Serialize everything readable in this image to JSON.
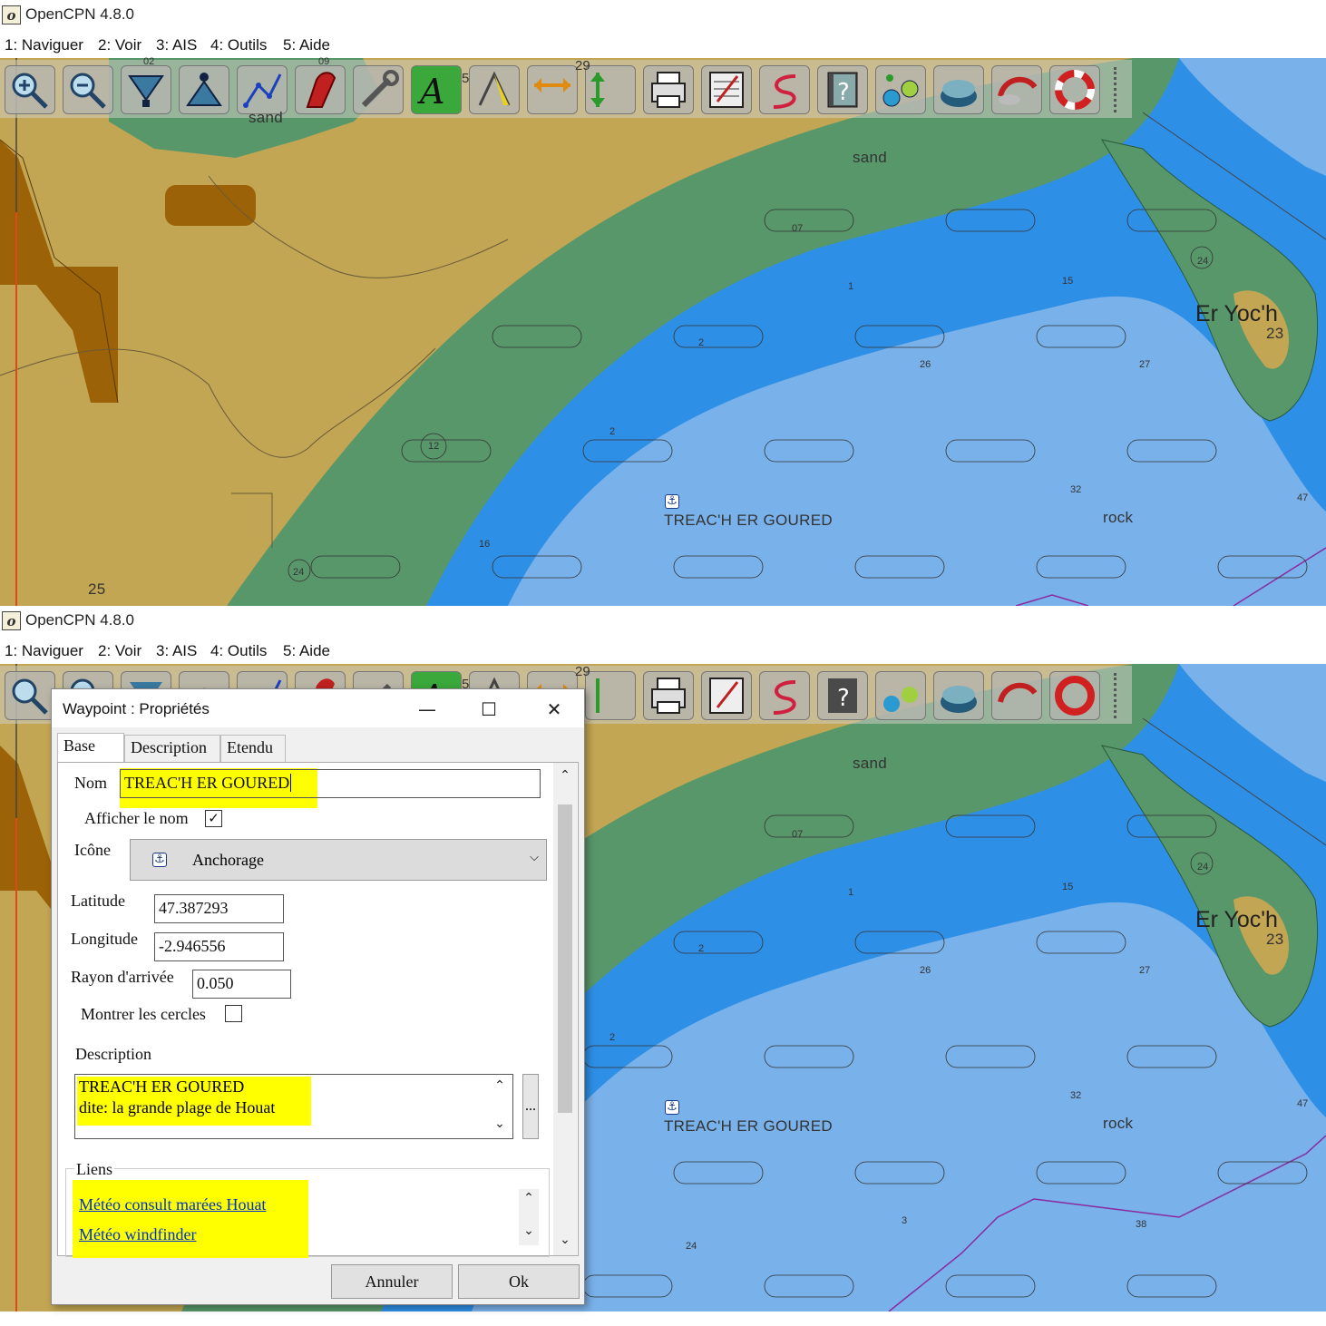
{
  "app": {
    "title": "OpenCPN 4.8.0"
  },
  "menu": [
    "1: Naviguer",
    "2: Voir",
    "3: AIS",
    "4: Outils",
    "5: Aide"
  ],
  "toolbar": {
    "buttons": [
      "zoom-in",
      "zoom-out",
      "scale-in",
      "scale-out",
      "route",
      "ship",
      "settings",
      "text",
      "measure",
      "tide",
      "current",
      "print",
      "route-manager",
      "track",
      "help",
      "ais",
      "layers",
      "weather",
      "man-overboard"
    ],
    "digits": {
      "a": "5",
      "b": "29",
      "c": "02",
      "d": "09"
    }
  },
  "chart": {
    "labels": {
      "sand_top": "sand",
      "sand_toolbar": "sand",
      "island": "Er Yoc'h",
      "island_depth": "23",
      "waypoint": "TREAC'H ER GOURED",
      "rock": "rock",
      "spot_25": "25"
    },
    "depths": [
      "07",
      "1",
      "15",
      "24",
      "2",
      "26",
      "27",
      "12",
      "2",
      "32",
      "47",
      "16",
      "24",
      "3",
      "38",
      "24"
    ],
    "colors": {
      "land": "#c3a653",
      "shallow_green": "#58976a",
      "deep_blue": "#2e8fe6",
      "light_blue": "#79b1ea",
      "brown": "#9b6207"
    }
  },
  "dialog": {
    "title": "Waypoint : Propriétés",
    "tabs": [
      "Base",
      "Description",
      "Etendu"
    ],
    "name_label": "Nom",
    "name_value": "TREAC'H ER GOURED",
    "show_name_label": "Afficher le nom",
    "show_name_checked": "✓",
    "icon_label": "Icône",
    "icon_value": "Anchorage",
    "lat_label": "Latitude",
    "lat_value": "47.387293",
    "lon_label": "Longitude",
    "lon_value": "-2.946556",
    "radius_label": "Rayon d'arrivée",
    "radius_value": "0.050",
    "circles_label": "Montrer les cercles",
    "desc_label": "Description",
    "desc_line1": "TREAC'H ER GOURED",
    "desc_line2": "dite: la grande plage de Houat",
    "desc_more": "...",
    "links_label": "Liens",
    "link1": "Météo consult marées Houat",
    "link2": "Météo windfinder",
    "cancel": "Annuler",
    "ok": "Ok"
  }
}
